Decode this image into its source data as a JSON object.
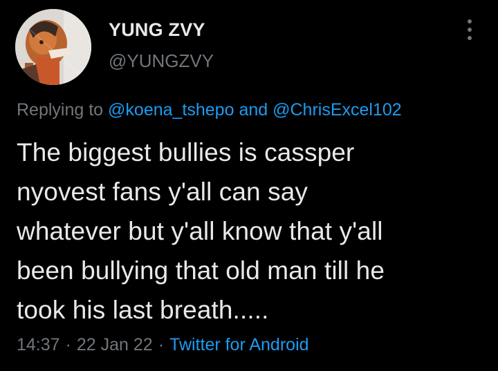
{
  "tweet": {
    "display_name": "YUNG ZVY",
    "handle": "@YUNGZVY",
    "replying_prefix": "Replying to",
    "reply_mention_1": "@koena_tshepo",
    "reply_and": "and",
    "reply_mention_2": "@ChrisExcel102",
    "text_lines": [
      "The biggest bullies is cassper",
      "nyovest fans y'all can say",
      "whatever but y'all know that y'all",
      "been bullying that old man till he",
      "took his last breath....."
    ],
    "time": "14:37",
    "date": "22 Jan 22",
    "separator": "·",
    "source": "Twitter for Android"
  },
  "icons": {
    "more": "vertical-dots-icon",
    "avatar": "profile-photo"
  },
  "colors": {
    "background": "#000000",
    "primary_text": "#e7e9ea",
    "secondary_text": "#71767b",
    "link": "#1d9bf0"
  }
}
